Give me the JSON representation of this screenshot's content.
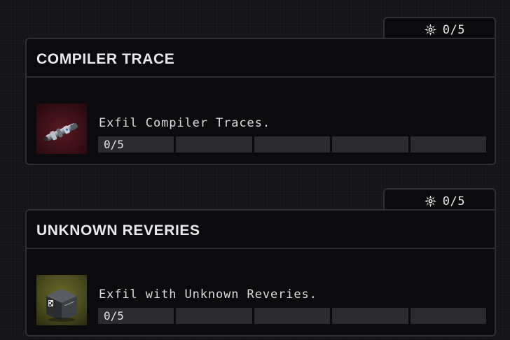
{
  "cards": [
    {
      "title": "COMPILER TRACE",
      "reward": "0/5",
      "reward_icon": "reward-burst-icon",
      "objective": "Exfil Compiler Traces.",
      "progress_label": "0/5",
      "progress": {
        "current": 0,
        "total": 5
      },
      "thumbnail_icon": "compiler-trace-item-icon"
    },
    {
      "title": "UNKNOWN REVERIES",
      "reward": "0/5",
      "reward_icon": "reward-burst-icon",
      "objective": "Exfil with Unknown Reveries.",
      "progress_label": "0/5",
      "progress": {
        "current": 0,
        "total": 5
      },
      "thumbnail_icon": "unknown-reveries-item-icon"
    }
  ],
  "colors": {
    "panel_bg": "#0b0b0d",
    "border": "#2e2e33",
    "segment": "#2a2a2f",
    "text": "#e9e9ec"
  }
}
